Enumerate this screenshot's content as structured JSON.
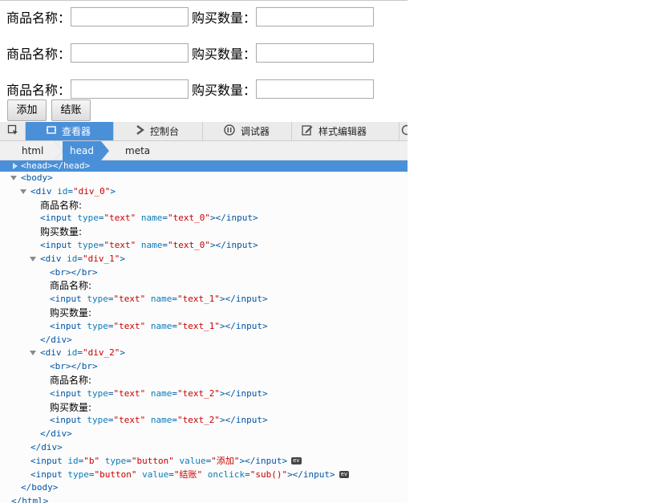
{
  "form": {
    "name_label": "商品名称：",
    "qty_label": "购买数量：",
    "rows": [
      {
        "name_value": "",
        "qty_value": ""
      },
      {
        "name_value": "",
        "qty_value": ""
      },
      {
        "name_value": "",
        "qty_value": ""
      }
    ],
    "add_button": "添加",
    "checkout_button": "结账"
  },
  "devtools": {
    "tabs": [
      {
        "label": "查看器",
        "icon": "inspector-icon",
        "active": true
      },
      {
        "label": "控制台",
        "icon": "console-icon",
        "active": false
      },
      {
        "label": "调试器",
        "icon": "debugger-icon",
        "active": false
      },
      {
        "label": "样式编辑器",
        "icon": "style-editor-icon",
        "active": false
      }
    ],
    "breadcrumbs": [
      "html",
      "head",
      "meta"
    ],
    "selected_crumb": "head",
    "accent_color": "#4a90d9",
    "tree": [
      {
        "indent": 0,
        "twisty": "closed",
        "selected": true,
        "parts": [
          [
            "tag",
            "<head></head>"
          ]
        ]
      },
      {
        "indent": 0,
        "twisty": "open",
        "parts": [
          [
            "tag",
            "<body>"
          ]
        ]
      },
      {
        "indent": 1,
        "twisty": "open",
        "parts": [
          [
            "tag",
            "<div "
          ],
          [
            "attr",
            "id"
          ],
          [
            "tag",
            "="
          ],
          [
            "val",
            "\"div_0\""
          ],
          [
            "tag",
            ">"
          ]
        ]
      },
      {
        "indent": 2,
        "parts": [
          [
            "plain",
            "商品名称:"
          ]
        ]
      },
      {
        "indent": 2,
        "parts": [
          [
            "tag",
            "<input "
          ],
          [
            "attr",
            "type"
          ],
          [
            "tag",
            "="
          ],
          [
            "val",
            "\"text\""
          ],
          [
            "tag",
            " "
          ],
          [
            "attr",
            "name"
          ],
          [
            "tag",
            "="
          ],
          [
            "val",
            "\"text_0\""
          ],
          [
            "tag",
            "></input>"
          ]
        ]
      },
      {
        "indent": 2,
        "parts": [
          [
            "plain",
            "购买数量:"
          ]
        ]
      },
      {
        "indent": 2,
        "parts": [
          [
            "tag",
            "<input "
          ],
          [
            "attr",
            "type"
          ],
          [
            "tag",
            "="
          ],
          [
            "val",
            "\"text\""
          ],
          [
            "tag",
            " "
          ],
          [
            "attr",
            "name"
          ],
          [
            "tag",
            "="
          ],
          [
            "val",
            "\"text_0\""
          ],
          [
            "tag",
            "></input>"
          ]
        ]
      },
      {
        "indent": 2,
        "twisty": "open",
        "parts": [
          [
            "tag",
            "<div "
          ],
          [
            "attr",
            "id"
          ],
          [
            "tag",
            "="
          ],
          [
            "val",
            "\"div_1\""
          ],
          [
            "tag",
            ">"
          ]
        ]
      },
      {
        "indent": 3,
        "parts": [
          [
            "tag",
            "<br></br>"
          ]
        ]
      },
      {
        "indent": 3,
        "parts": [
          [
            "plain",
            "商品名称:"
          ]
        ]
      },
      {
        "indent": 3,
        "parts": [
          [
            "tag",
            "<input "
          ],
          [
            "attr",
            "type"
          ],
          [
            "tag",
            "="
          ],
          [
            "val",
            "\"text\""
          ],
          [
            "tag",
            " "
          ],
          [
            "attr",
            "name"
          ],
          [
            "tag",
            "="
          ],
          [
            "val",
            "\"text_1\""
          ],
          [
            "tag",
            "></input>"
          ]
        ]
      },
      {
        "indent": 3,
        "parts": [
          [
            "plain",
            "购买数量:"
          ]
        ]
      },
      {
        "indent": 3,
        "parts": [
          [
            "tag",
            "<input "
          ],
          [
            "attr",
            "type"
          ],
          [
            "tag",
            "="
          ],
          [
            "val",
            "\"text\""
          ],
          [
            "tag",
            " "
          ],
          [
            "attr",
            "name"
          ],
          [
            "tag",
            "="
          ],
          [
            "val",
            "\"text_1\""
          ],
          [
            "tag",
            "></input>"
          ]
        ]
      },
      {
        "indent": 2,
        "parts": [
          [
            "tag",
            "</div>"
          ]
        ]
      },
      {
        "indent": 2,
        "twisty": "open",
        "parts": [
          [
            "tag",
            "<div "
          ],
          [
            "attr",
            "id"
          ],
          [
            "tag",
            "="
          ],
          [
            "val",
            "\"div_2\""
          ],
          [
            "tag",
            ">"
          ]
        ]
      },
      {
        "indent": 3,
        "parts": [
          [
            "tag",
            "<br></br>"
          ]
        ]
      },
      {
        "indent": 3,
        "parts": [
          [
            "plain",
            "商品名称:"
          ]
        ]
      },
      {
        "indent": 3,
        "parts": [
          [
            "tag",
            "<input "
          ],
          [
            "attr",
            "type"
          ],
          [
            "tag",
            "="
          ],
          [
            "val",
            "\"text\""
          ],
          [
            "tag",
            " "
          ],
          [
            "attr",
            "name"
          ],
          [
            "tag",
            "="
          ],
          [
            "val",
            "\"text_2\""
          ],
          [
            "tag",
            "></input>"
          ]
        ]
      },
      {
        "indent": 3,
        "parts": [
          [
            "plain",
            "购买数量:"
          ]
        ]
      },
      {
        "indent": 3,
        "parts": [
          [
            "tag",
            "<input "
          ],
          [
            "attr",
            "type"
          ],
          [
            "tag",
            "="
          ],
          [
            "val",
            "\"text\""
          ],
          [
            "tag",
            " "
          ],
          [
            "attr",
            "name"
          ],
          [
            "tag",
            "="
          ],
          [
            "val",
            "\"text_2\""
          ],
          [
            "tag",
            "></input>"
          ]
        ]
      },
      {
        "indent": 2,
        "parts": [
          [
            "tag",
            "</div>"
          ]
        ]
      },
      {
        "indent": 1,
        "parts": [
          [
            "tag",
            "</div>"
          ]
        ]
      },
      {
        "indent": 1,
        "ev": true,
        "parts": [
          [
            "tag",
            "<input "
          ],
          [
            "attr",
            "id"
          ],
          [
            "tag",
            "="
          ],
          [
            "val",
            "\"b\""
          ],
          [
            "tag",
            " "
          ],
          [
            "attr",
            "type"
          ],
          [
            "tag",
            "="
          ],
          [
            "val",
            "\"button\""
          ],
          [
            "tag",
            " "
          ],
          [
            "attr",
            "value"
          ],
          [
            "tag",
            "="
          ],
          [
            "val",
            "\"添加\""
          ],
          [
            "tag",
            "></input>"
          ]
        ]
      },
      {
        "indent": 1,
        "ev": true,
        "parts": [
          [
            "tag",
            "<input "
          ],
          [
            "attr",
            "type"
          ],
          [
            "tag",
            "="
          ],
          [
            "val",
            "\"button\""
          ],
          [
            "tag",
            " "
          ],
          [
            "attr",
            "value"
          ],
          [
            "tag",
            "="
          ],
          [
            "val",
            "\"结账\""
          ],
          [
            "tag",
            " "
          ],
          [
            "attr",
            "onclick"
          ],
          [
            "tag",
            "="
          ],
          [
            "val",
            "\"sub()\""
          ],
          [
            "tag",
            "></input>"
          ]
        ]
      },
      {
        "indent": 0,
        "parts": [
          [
            "tag",
            "</body>"
          ]
        ]
      },
      {
        "indent": -1,
        "parts": [
          [
            "tag",
            "</html>"
          ]
        ]
      }
    ],
    "event_badge": "ev"
  }
}
